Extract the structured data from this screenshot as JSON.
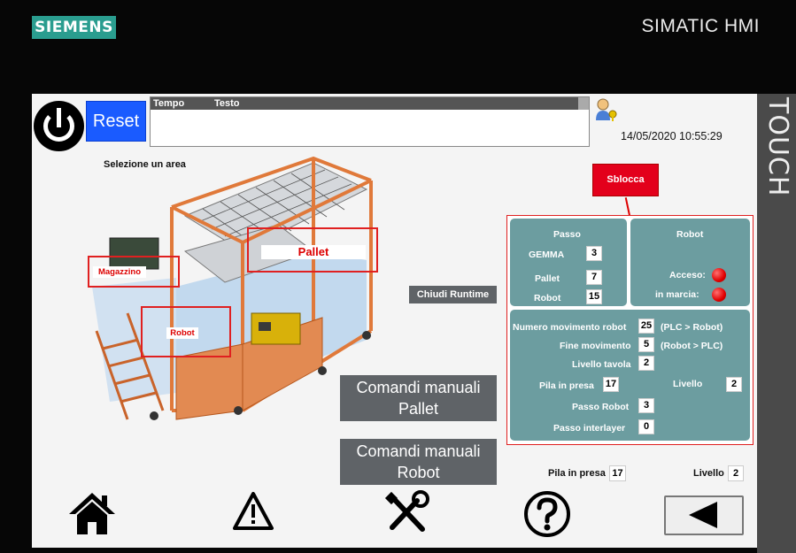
{
  "bezel": {
    "brand": "SIEMENS",
    "product": "SIMATIC HMI",
    "touch": "TOUCH"
  },
  "header": {
    "reset_label": "Reset",
    "col_time": "Tempo",
    "col_text": "Testo",
    "datetime": "14/05/2020 10:55:29"
  },
  "area": {
    "title": "Selezione un area",
    "zones": {
      "magazzino": "Magazzino",
      "pallet": "Pallet",
      "robot": "Robot"
    }
  },
  "buttons": {
    "chiudi": "Chiudi Runtime",
    "sblocca": "Sblocca",
    "manual_pallet": [
      "Comandi manuali",
      "Pallet"
    ],
    "manual_robot": [
      "Comandi manuali",
      "Robot"
    ]
  },
  "passo": {
    "title": "Passo",
    "gemma_label": "GEMMA",
    "gemma": "3",
    "pallet_label": "Pallet",
    "pallet": "7",
    "robot_label": "Robot",
    "robot": "15"
  },
  "robot": {
    "title": "Robot",
    "acceso_label": "Acceso:",
    "marcia_label": "in marcia:",
    "acceso_color": "#e00000",
    "marcia_color": "#e00000"
  },
  "details": {
    "num_mov_label": "Numero movimento robot",
    "num_mov": "25",
    "num_mov_note": "(PLC > Robot)",
    "fine_mov_label": "Fine movimento",
    "fine_mov": "5",
    "fine_mov_note": "(Robot > PLC)",
    "livello_tavola_label": "Livello tavola",
    "livello_tavola": "2",
    "pila_label": "Pila in presa",
    "pila": "17",
    "livello_label": "Livello",
    "livello": "2",
    "passo_robot_label": "Passo Robot",
    "passo_robot": "3",
    "passo_inter_label": "Passo interlayer",
    "passo_inter": "0"
  },
  "footer": {
    "pila_label": "Pila in presa",
    "pila": "17",
    "livello_label": "Livello",
    "livello": "2"
  },
  "nav": {
    "icons": [
      "home-icon",
      "warning-icon",
      "tools-icon",
      "help-icon",
      "back-arrow-icon"
    ]
  }
}
